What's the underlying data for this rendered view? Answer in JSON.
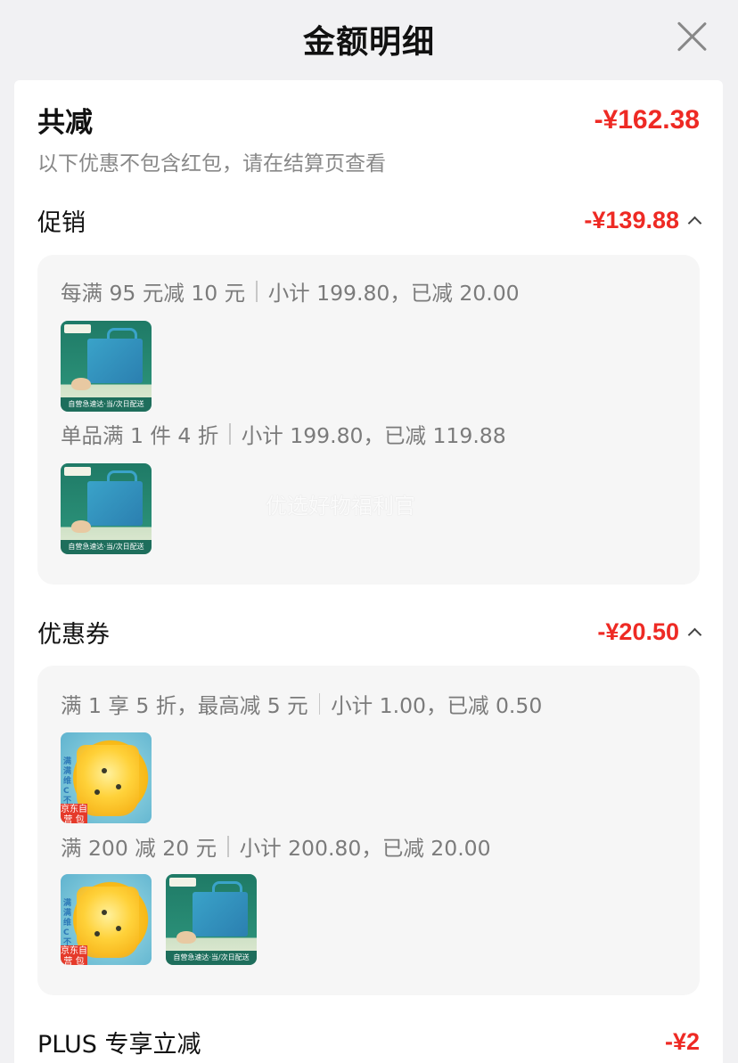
{
  "header": {
    "title": "金额明细"
  },
  "total": {
    "label": "共减",
    "amount": "-¥162.38",
    "note": "以下优惠不包含红包，请在结算页查看"
  },
  "promotion": {
    "label": "促销",
    "amount": "-¥139.88",
    "rules": [
      {
        "desc": "每满 95 元减 10 元",
        "summary": "小计 199.80，已减 20.00"
      },
      {
        "desc": "单品满 1 件 4 折",
        "summary": "小计 199.80，已减 119.88"
      }
    ]
  },
  "coupon": {
    "label": "优惠券",
    "amount": "-¥20.50",
    "rules": [
      {
        "desc": "满 1 享 5 折，最高减 5 元",
        "summary": "小计 1.00，已减 0.50"
      },
      {
        "desc": "满 200 减 20 元",
        "summary": "小计 200.80，已减 20.00"
      }
    ]
  },
  "plus": {
    "label": "PLUS 专享立减",
    "amount": "-¥2"
  },
  "watermark": "优选好物福利官",
  "product_thumbs": {
    "gift_box_strip": "自营急速达·当/次日配送",
    "juice_badge": "京东自营 包邮",
    "juice_side_text": "满满维C 不倒"
  }
}
